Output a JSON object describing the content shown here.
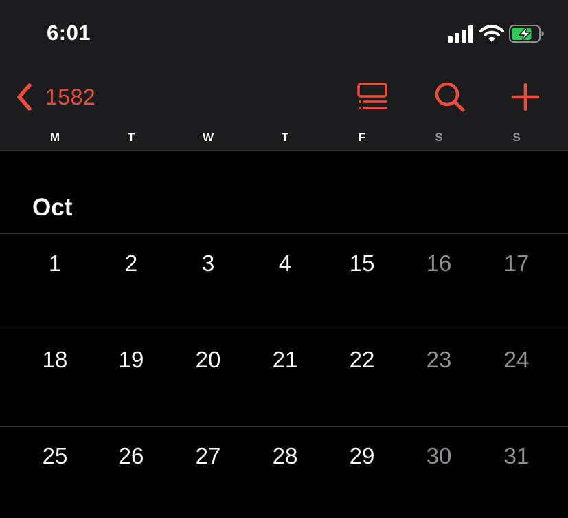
{
  "status_bar": {
    "time": "6:01",
    "signal_icon": "cellular-signal-icon",
    "wifi_icon": "wifi-icon",
    "battery_icon": "battery-charging-icon",
    "battery_level": 0.75
  },
  "nav": {
    "back_label": "1582",
    "back_icon": "chevron-left-icon",
    "list_icon": "list-view-icon",
    "search_icon": "search-icon",
    "add_icon": "plus-icon"
  },
  "weekdays": [
    "M",
    "T",
    "W",
    "T",
    "F",
    "S",
    "S"
  ],
  "month": "Oct",
  "weeks": [
    [
      "1",
      "2",
      "3",
      "4",
      "15",
      "16",
      "17"
    ],
    [
      "18",
      "19",
      "20",
      "21",
      "22",
      "23",
      "24"
    ],
    [
      "25",
      "26",
      "27",
      "28",
      "29",
      "30",
      "31"
    ]
  ],
  "colors": {
    "accent": "#eb4d3d",
    "header_bg": "#1c1c1e",
    "background": "#000000",
    "text": "#ffffff",
    "weekend_text": "#8e8e93",
    "battery_fill": "#34c759"
  }
}
